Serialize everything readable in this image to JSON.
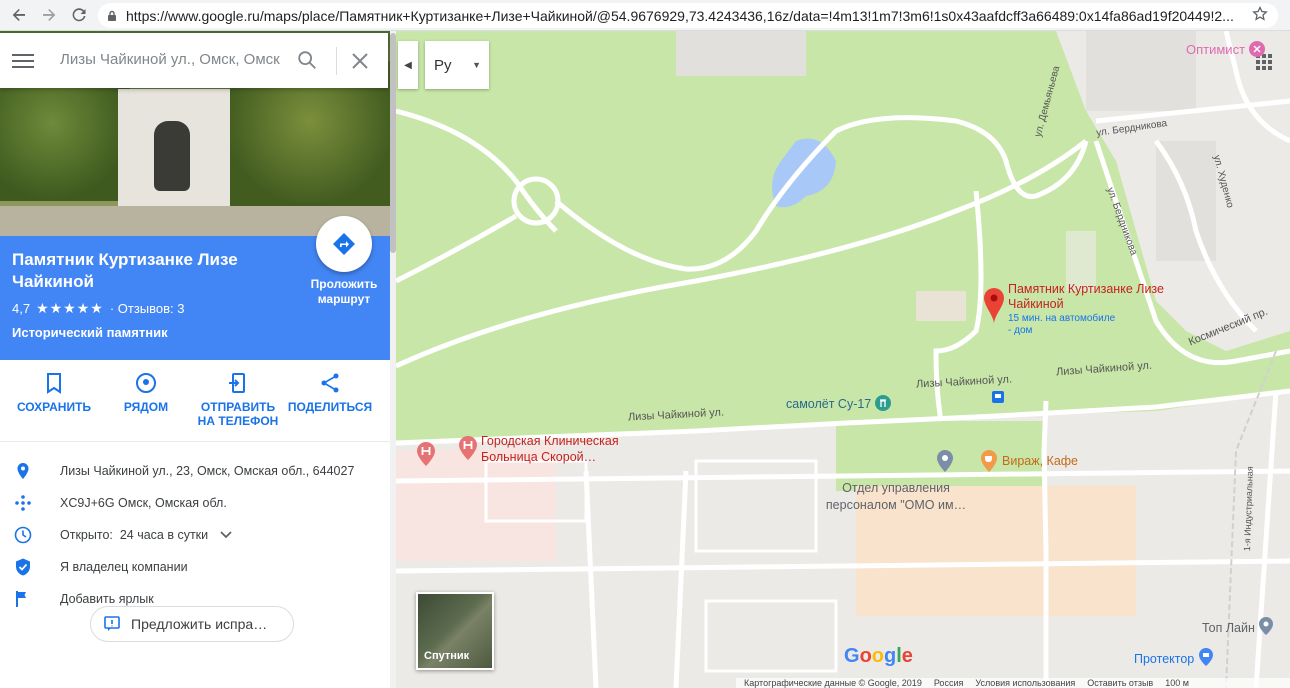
{
  "browser": {
    "url": "https://www.google.ru/maps/place/Памятник+Куртизанке+Лизе+Чайкиной/@54.9676929,73.4243436,16z/data=!4m13!1m7!3m6!1s0x43aafdcff3a66489:0x14fa86ad19f20449!2..."
  },
  "search": {
    "placeholder": "Лизы Чайкиной ул., Омск, Омск"
  },
  "place": {
    "title": "Памятник Куртизанке Лизе Чайкиной",
    "rating": "4,7",
    "stars": "★★★★★",
    "reviews": "· Отзывов: 3",
    "category": "Исторический памятник",
    "route_label": "Проложить маршрут"
  },
  "actions": [
    {
      "label": "СОХРАНИТЬ"
    },
    {
      "label": "РЯДОМ"
    },
    {
      "label": "ОТПРАВИТЬ НА ТЕЛЕФОН"
    },
    {
      "label": "ПОДЕЛИТЬСЯ"
    }
  ],
  "info": {
    "address": "Лизы Чайкиной ул., 23, Омск, Омская обл., 644027",
    "pluscode": "XC9J+6G Омск, Омская обл.",
    "hours_label": "Открыто:",
    "hours_value": "24 часа в сутки",
    "owner": "Я владелец компании",
    "label": "Добавить ярлык"
  },
  "suggest_edit": "Предложить испра…",
  "map": {
    "lang_button": "Ру",
    "labels": {
      "optimist": "Оптимист",
      "street_berdnikova1": "ул. Бердникова",
      "street_berdnikova2": "ул. Бердникова",
      "street_demyanieva": "ул. Демьяньева",
      "street_khudenko": "ул. Худенко",
      "street_kosmicheskiy": "Космический пр.",
      "street_chaikinoy1": "Лизы Чайкиной ул.",
      "street_chaikinoy2": "Лизы Чайкиной ул.",
      "street_chaikinoy3": "Лизы Чайкиной ул.",
      "street_industrialnaya": "1-я Индустриальная",
      "pin_title": "Памятник Куртизанке Лизе Чайкиной",
      "pin_subtitle": "15 мин. на автомобиле - дом",
      "samolet": "самолёт Су-17",
      "hospital": "Городская Клиническая Больница Скорой…",
      "virazh": "Вираж, Кафе",
      "otdel": "Отдел управления персоналом \"ОМО им…",
      "toplain": "Топ Лайн",
      "protektor": "Протектор",
      "satellite": "Спутник"
    },
    "footer": [
      "Картографические данные © Google, 2019",
      "Россия",
      "Условия использования",
      "Оставить отзыв",
      "100 м"
    ],
    "colors": {
      "park": "#c8e6a8",
      "road": "#ffffff",
      "water": "#a8c8f8",
      "pin": "#ea4335",
      "hospital_area": "#f8e4e0",
      "accent_blue": "#4285f4"
    }
  }
}
